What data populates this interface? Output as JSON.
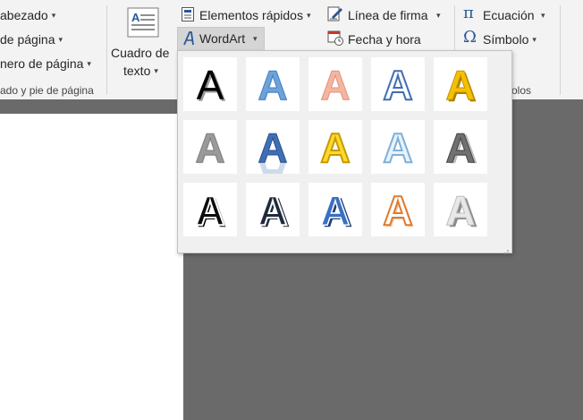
{
  "ribbon": {
    "header_label": "abezado",
    "footer_label": "de página",
    "page_number_label": "nero de página",
    "header_footer_group": "ado y pie de página",
    "text_box_line1": "Cuadro de",
    "text_box_line2": "texto",
    "quick_parts_label": "Elementos rápidos",
    "wordart_label": "WordArt",
    "signature_line_label": "Línea de firma",
    "date_time_label": "Fecha y hora",
    "equation_label": "Ecuación",
    "symbol_label": "Símbolo",
    "symbols_group": "olos"
  },
  "gallery": {
    "glyph": "A",
    "styles": [
      {
        "name": "fill-black-shadow",
        "fill": "#000000"
      },
      {
        "name": "fill-blue-gradient",
        "fill": "#6fa3d8"
      },
      {
        "name": "fill-orange-soft",
        "fill": "#f3b6a0"
      },
      {
        "name": "outline-blue",
        "fill": "#ffffff"
      },
      {
        "name": "fill-gold",
        "fill": "#f2c200"
      },
      {
        "name": "fill-gray-gradient",
        "fill": "#9a9a9a"
      },
      {
        "name": "fill-blue-reflection",
        "fill": "#3f6fb5"
      },
      {
        "name": "fill-yellow-outline",
        "fill": "#ffd92e"
      },
      {
        "name": "outline-light-blue",
        "fill": "#e8f2fa"
      },
      {
        "name": "fill-gray-bevel",
        "fill": "#707070"
      },
      {
        "name": "fill-black-outline",
        "fill": "#0d0d0d"
      },
      {
        "name": "fill-dark-blue-outline",
        "fill": "#1f2a3c"
      },
      {
        "name": "fill-blue-3d",
        "fill": "#3a6fc4"
      },
      {
        "name": "outline-orange",
        "fill": "#ffffff"
      },
      {
        "name": "fill-white-bevel",
        "fill": "#e8e8e8"
      }
    ]
  }
}
